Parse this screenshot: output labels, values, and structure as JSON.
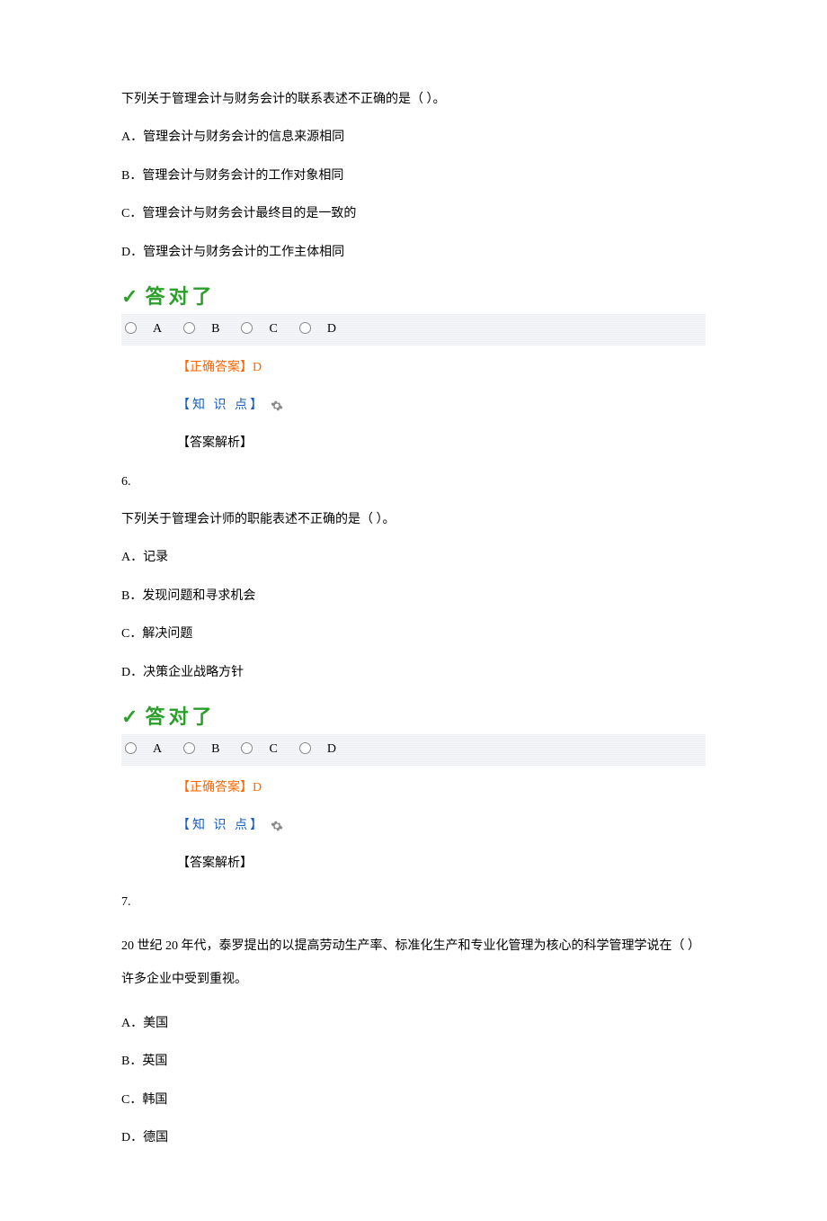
{
  "q5": {
    "text": "下列关于管理会计与财务会计的联系表述不正确的是（ ）。",
    "optA": "A．管理会计与财务会计的信息来源相同",
    "optB": "B．管理会计与财务会计的工作对象相同",
    "optC": "C．管理会计与财务会计最终目的是一致的",
    "optD": "D．管理会计与财务会计的工作主体相同",
    "correctBanner": "答对了",
    "radioA": "A",
    "radioB": "B",
    "radioC": "C",
    "radioD": "D",
    "correctLabel": "【正确答案】",
    "correctValue": "D",
    "knowledgeLabel": "【知 识 点】",
    "analysisLabel": "【答案解析】"
  },
  "q6": {
    "number": "6.",
    "text": "下列关于管理会计师的职能表述不正确的是（ ）。",
    "optA": "A．记录",
    "optB": "B．发现问题和寻求机会",
    "optC": "C．解决问题",
    "optD": "D．决策企业战略方针",
    "correctBanner": "答对了",
    "radioA": "A",
    "radioB": "B",
    "radioC": "C",
    "radioD": "D",
    "correctLabel": "【正确答案】",
    "correctValue": "D",
    "knowledgeLabel": "【知 识 点】",
    "analysisLabel": "【答案解析】"
  },
  "q7": {
    "number": "7.",
    "text": "20 世纪 20 年代，泰罗提出的以提高劳动生产率、标准化生产和专业化管理为核心的科学管理学说在（ ）许多企业中受到重视。",
    "optA": "A．美国",
    "optB": "B．英国",
    "optC": "C．韩国",
    "optD": "D．德国"
  }
}
